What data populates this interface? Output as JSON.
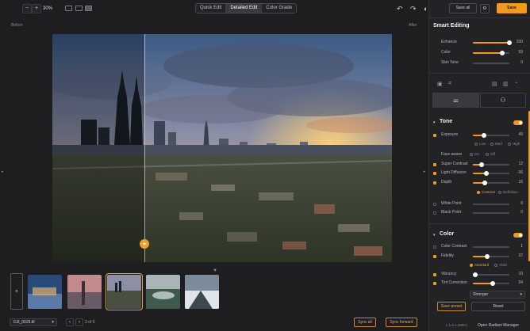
{
  "topbar": {
    "zoom_minus": "−",
    "zoom_plus": "+",
    "zoom_level": "30%",
    "modes": [
      {
        "label": "Quick Edit",
        "active": false
      },
      {
        "label": "Detailed Edit",
        "active": true
      },
      {
        "label": "Color Grade",
        "active": false
      }
    ]
  },
  "canvas": {
    "before_label": "Before",
    "after_label": "After",
    "handle_icon": "◂▸"
  },
  "panel_top": {
    "save_all": "Save all",
    "save": "Save"
  },
  "smart_editing": {
    "title": "Smart Editing",
    "sliders": [
      {
        "label": "Enhance",
        "value": "100",
        "level": 1.0
      },
      {
        "label": "Color",
        "value": "93",
        "level": 0.93
      },
      {
        "label": "Skin Tone",
        "value": "0",
        "level": 0.0
      }
    ]
  },
  "tone": {
    "title": "Tone",
    "exposure": {
      "label": "Exposure",
      "value": "49",
      "level": 0.49
    },
    "face_aware": {
      "label": "Face aware",
      "options": [
        "Low",
        "Med",
        "High"
      ],
      "toggle": [
        "On",
        "Off"
      ]
    },
    "sliders": [
      {
        "label": "Super Contrast",
        "value": "12",
        "level": 0.12
      },
      {
        "label": "Light Diffusion",
        "value": "-36",
        "level": 0.32
      },
      {
        "label": "Depth",
        "value": "16",
        "level": 0.58
      }
    ],
    "contrast_modes": [
      "Contrast",
      "Definition"
    ],
    "points": [
      {
        "label": "White Point",
        "value": "0"
      },
      {
        "label": "Black Point",
        "value": "0"
      }
    ]
  },
  "color": {
    "title": "Color",
    "color_contrast": {
      "label": "Color Contrast",
      "value": "1"
    },
    "fidelity": {
      "label": "Fidelity",
      "value": "37",
      "level": 0.37
    },
    "fidelity_modes": [
      "Standard",
      "Vivid"
    ],
    "sliders": [
      {
        "label": "Vibrancy",
        "value": "10",
        "level": 0.1
      },
      {
        "label": "Tint Correction",
        "value": "54",
        "level": 0.54
      }
    ],
    "strength": "Stronger"
  },
  "panel_bottom": {
    "save_preset": "Save preset",
    "reset": "Reset",
    "version": "v 1.4.1.1800 |",
    "manager": "Open Radiant Manager"
  },
  "bottombar": {
    "file_name": "DJI_0025.tif",
    "pager": "3 of 5",
    "sync_all": "Sync all",
    "sync_forward": "Sync forward"
  },
  "colors": {
    "accent": "#f29a1f",
    "panel_bg": "#232326",
    "app_bg": "#1e1e20"
  }
}
